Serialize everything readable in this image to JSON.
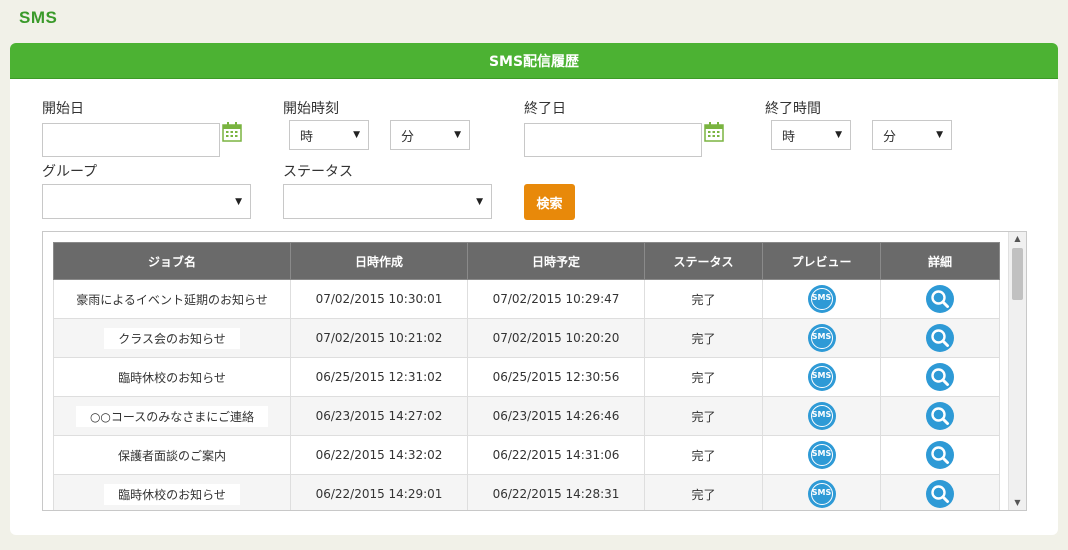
{
  "app": {
    "title": "SMS"
  },
  "panel": {
    "title": "SMS配信履歴"
  },
  "filters": {
    "start_date_label": "開始日",
    "start_time_label": "開始時刻",
    "end_date_label": "終了日",
    "end_time_label": "終了時間",
    "group_label": "グループ",
    "status_label": "ステータス",
    "hour_value": "時",
    "minute_value": "分",
    "group_value": "",
    "status_value": ""
  },
  "search_button": "検索",
  "table": {
    "headers": [
      "ジョブ名",
      "日時作成",
      "日時予定",
      "ステータス",
      "プレビュー",
      "詳細"
    ],
    "rows": [
      {
        "name": "豪雨によるイベント延期のお知らせ",
        "created": "07/02/2015 10:30:01",
        "scheduled": "07/02/2015 10:29:47",
        "status": "完了"
      },
      {
        "name": "クラス会のお知らせ",
        "created": "07/02/2015 10:21:02",
        "scheduled": "07/02/2015 10:20:20",
        "status": "完了"
      },
      {
        "name": "臨時休校のお知らせ",
        "created": "06/25/2015 12:31:02",
        "scheduled": "06/25/2015 12:30:56",
        "status": "完了"
      },
      {
        "name": "○○コースのみなさまにご連絡",
        "created": "06/23/2015 14:27:02",
        "scheduled": "06/23/2015 14:26:46",
        "status": "完了"
      },
      {
        "name": "保護者面談のご案内",
        "created": "06/22/2015 14:32:02",
        "scheduled": "06/22/2015 14:31:06",
        "status": "完了"
      },
      {
        "name": "臨時休校のお知らせ",
        "created": "06/22/2015 14:29:01",
        "scheduled": "06/22/2015 14:28:31",
        "status": "完了"
      },
      {
        "name": "",
        "created": "",
        "scheduled": "",
        "status": ""
      }
    ],
    "preview_icon_text": "SMS"
  },
  "icons": {
    "calendar": "calendar-icon",
    "preview": "sms-preview-icon",
    "detail": "magnifier-icon",
    "dropdown": "chevron-down-icon"
  },
  "colors": {
    "brand_green": "#4cb233",
    "title_green": "#3a9a2a",
    "search_orange": "#e8890a",
    "icon_blue": "#2e9ad6",
    "header_gray": "#6a6a6a"
  }
}
